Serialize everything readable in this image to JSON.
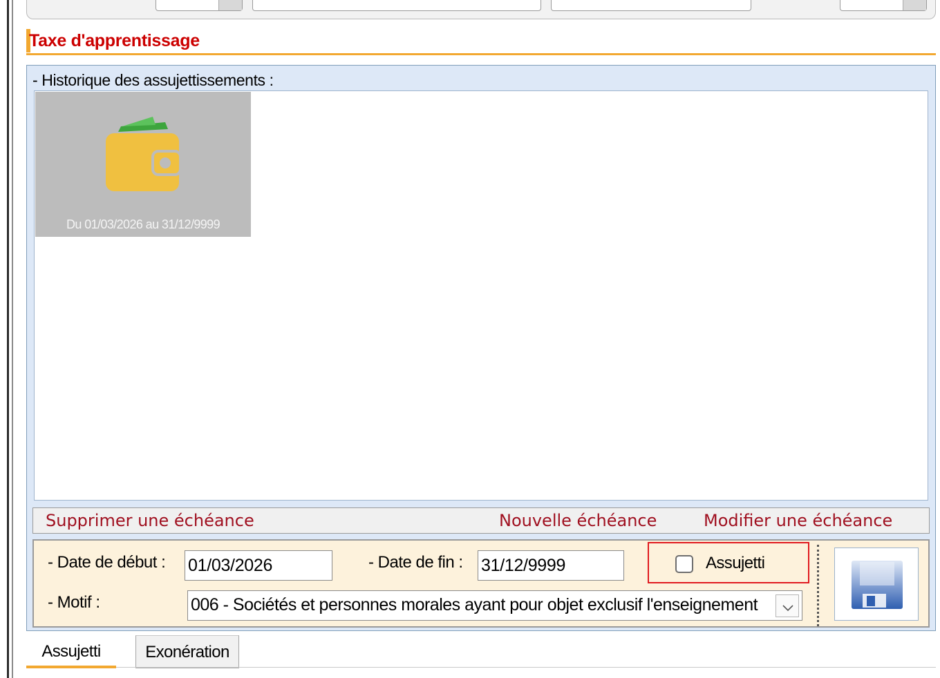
{
  "title": "Taxe d'apprentissage",
  "history": {
    "label": "- Historique des assujettissements :",
    "items": [
      {
        "text": "Du 01/03/2026 au 31/12/9999",
        "icon": "wallet-icon"
      }
    ]
  },
  "actions": {
    "delete": "Supprimer une échéance",
    "new": "Nouvelle échéance",
    "edit": "Modifier une échéance"
  },
  "form": {
    "start_label": "- Date de début :",
    "start_value": "01/03/2026",
    "end_label": "- Date de fin :",
    "end_value": "31/12/9999",
    "assujetti_label": "Assujetti",
    "assujetti_checked": false,
    "motif_label": "- Motif :",
    "motif_value": "006 - Sociétés et personnes morales ayant pour objet exclusif l'enseignement"
  },
  "save_icon": "floppy-disk-icon",
  "tabs": [
    {
      "label": "Assujetti",
      "active": true
    },
    {
      "label": "Exonération",
      "active": false
    }
  ],
  "colors": {
    "title": "#cc0000",
    "accent": "#f2a830",
    "action_link": "#a01020",
    "highlight_border": "#e0191e",
    "panel_bg": "#dde8f7",
    "form_bg": "#fdf2dc"
  }
}
